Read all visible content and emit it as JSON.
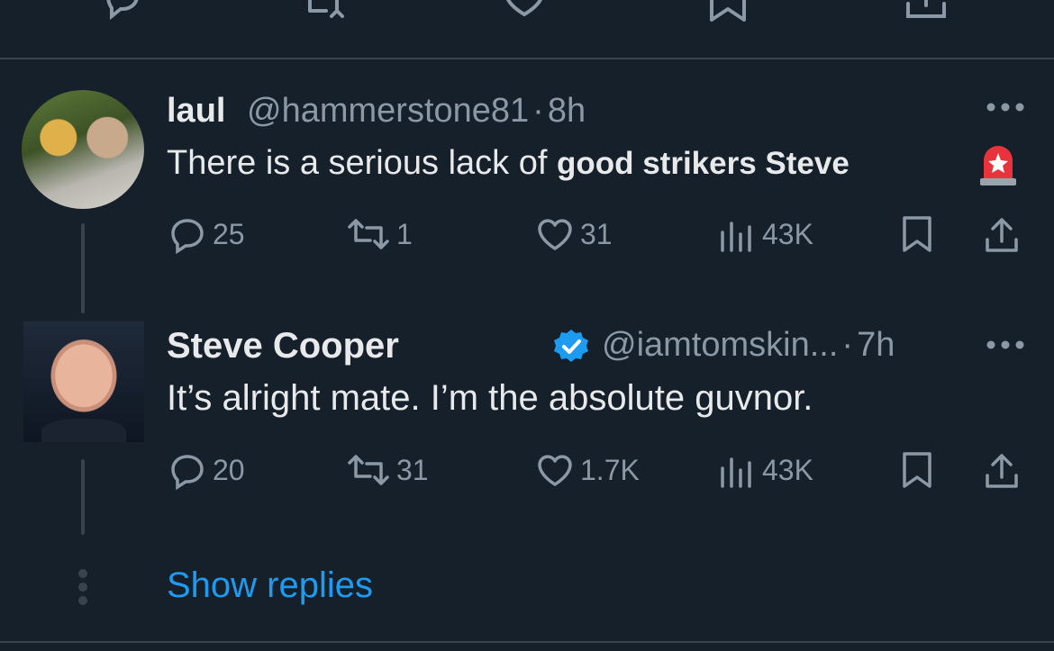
{
  "colors": {
    "background": "#15202b",
    "text": "#e7e9ea",
    "muted": "#8b98a5",
    "accent": "#1d9bf0",
    "divider": "#38444d"
  },
  "top_actions": [
    {
      "icon": "reply-icon"
    },
    {
      "icon": "retweet-icon"
    },
    {
      "icon": "like-icon"
    },
    {
      "icon": "bookmark-icon"
    },
    {
      "icon": "share-icon"
    }
  ],
  "tweets": [
    {
      "display_name": "laul",
      "handle": "@hammerstone81",
      "time": "8h",
      "text_prefix": "There is a serious lack of ",
      "text_bold": "good strikers Steve",
      "emoji": "🚨",
      "verified": false,
      "stats": {
        "replies": "25",
        "retweets": "1",
        "likes": "31",
        "views": "43K"
      }
    },
    {
      "display_name": "Steve Cooper",
      "handle": "@iamtomskin...",
      "time": "7h",
      "text": "It’s alright mate. I’m the absolute guvnor.",
      "verified": true,
      "stats": {
        "replies": "20",
        "retweets": "31",
        "likes": "1.7K",
        "views": "43K"
      }
    }
  ],
  "separator": "·",
  "show_replies": "Show replies"
}
